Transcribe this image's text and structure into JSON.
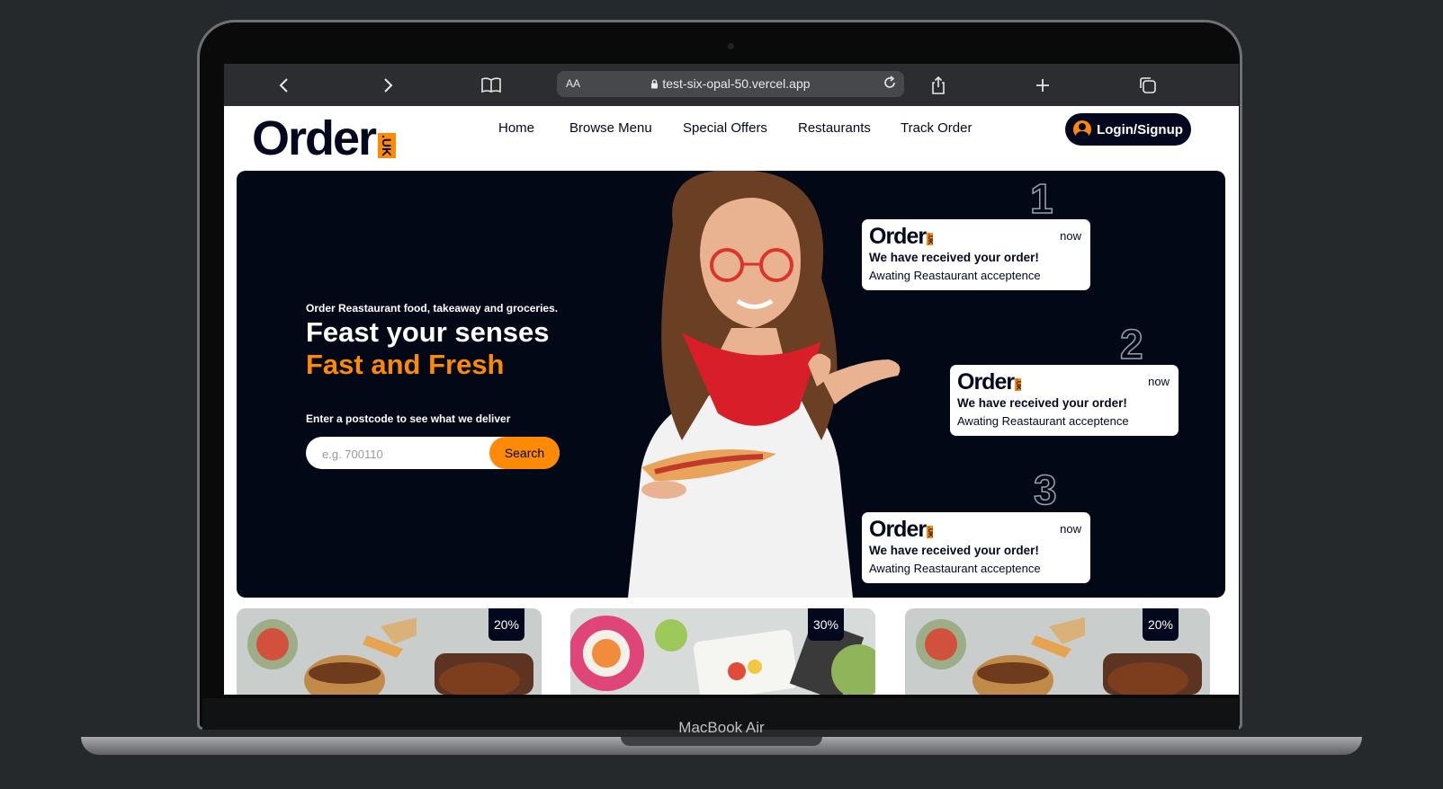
{
  "device": {
    "label": "MacBook Air"
  },
  "browser": {
    "address_aa": "AA",
    "url": "test-six-opal-50.vercel.app"
  },
  "site": {
    "logo_word": "Order",
    "logo_tag": ".UK",
    "nav": [
      "Home",
      "Browse Menu",
      "Special Offers",
      "Restaurants",
      "Track Order"
    ],
    "login_label": "Login/Signup",
    "accent_color": "#fc8a06",
    "dark_color": "#03081f"
  },
  "hero": {
    "tagline": "Order Reastaurant food, takeaway and groceries.",
    "title_line1": "Feast your senses",
    "title_line2": "Fast and Fresh",
    "postcode_label": "Enter a postcode to see what we deliver",
    "postcode_placeholder": "e.g. 700110",
    "search_label": "Search",
    "notifications": [
      {
        "step": "1",
        "time": "now",
        "message": "We have received your order!",
        "status": "Awating Reastaurant acceptence"
      },
      {
        "step": "2",
        "time": "now",
        "message": "We have received your order!",
        "status": "Awating Reastaurant acceptence"
      },
      {
        "step": "3",
        "time": "now",
        "message": "We have received your order!",
        "status": "Awating Reastaurant acceptence"
      }
    ]
  },
  "offers": [
    {
      "discount": "20%"
    },
    {
      "discount": "30%"
    },
    {
      "discount": "20%"
    }
  ]
}
